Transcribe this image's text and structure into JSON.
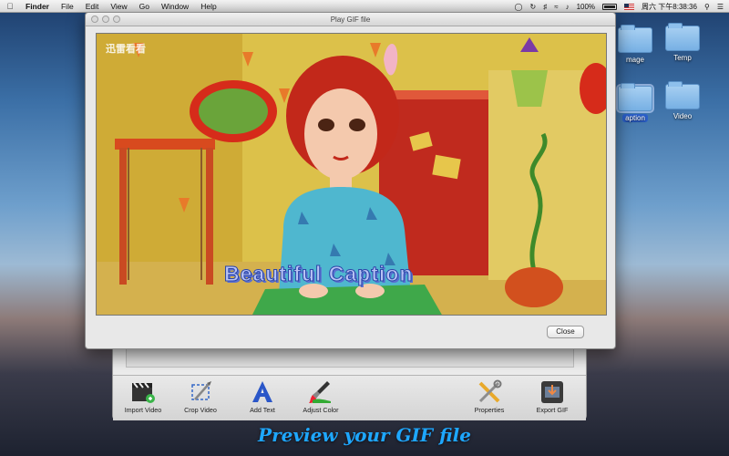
{
  "menubar": {
    "app": "Finder",
    "items": [
      "File",
      "Edit",
      "View",
      "Go",
      "Window",
      "Help"
    ],
    "battery": "100%",
    "clock": "周六 下午8:38:36"
  },
  "desktop": {
    "folders": [
      {
        "label": "mage"
      },
      {
        "label": "Temp"
      },
      {
        "label": "aption"
      },
      {
        "label": "Video"
      }
    ]
  },
  "gif_window": {
    "title": "Play GIF file",
    "watermark": "迅雷看看",
    "caption_text": "Beautiful Caption",
    "close_label": "Close"
  },
  "toolbar": {
    "buttons": [
      {
        "label": "Import Video",
        "icon": "clapperboard-icon"
      },
      {
        "label": "Crop Video",
        "icon": "crop-icon"
      },
      {
        "label": "Add Text",
        "icon": "letter-a-icon"
      },
      {
        "label": "Adjust Color",
        "icon": "paint-brush-icon"
      },
      {
        "label": "Properties",
        "icon": "tools-icon"
      },
      {
        "label": "Export GIF",
        "icon": "film-export-icon"
      }
    ]
  },
  "promo_caption": "Preview your GIF file",
  "colors": {
    "caption_blue": "#1ea7ff",
    "selection_blue": "#2b5fc9"
  }
}
